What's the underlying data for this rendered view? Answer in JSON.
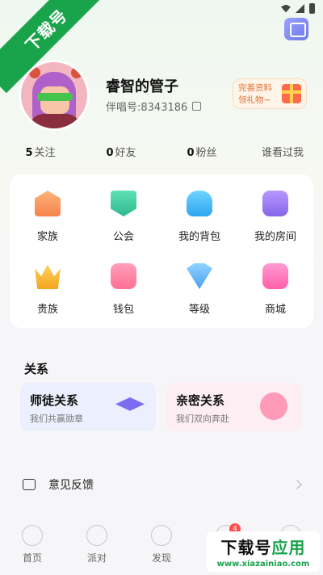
{
  "watermark": {
    "corner_text": "下载号",
    "brand_prefix": "下载号",
    "brand_suffix": "应用",
    "brand_url": "www.xiazainiao.com"
  },
  "profile": {
    "username": "睿智的管子",
    "uid": "伴唱号:8343186",
    "complete_card_line1": "完善资料",
    "complete_card_line2": "领礼物~"
  },
  "stats": [
    {
      "count": "5",
      "label": "关注"
    },
    {
      "count": "0",
      "label": "好友"
    },
    {
      "count": "0",
      "label": "粉丝"
    },
    {
      "count": "",
      "label": "谁看过我"
    }
  ],
  "grid": [
    {
      "label": "家族",
      "icon": "family-icon"
    },
    {
      "label": "公会",
      "icon": "guild-icon"
    },
    {
      "label": "我的背包",
      "icon": "backpack-icon"
    },
    {
      "label": "我的房间",
      "icon": "room-icon"
    },
    {
      "label": "贵族",
      "icon": "crown-icon"
    },
    {
      "label": "钱包",
      "icon": "wallet-icon"
    },
    {
      "label": "等级",
      "icon": "level-icon"
    },
    {
      "label": "商城",
      "icon": "mall-icon"
    }
  ],
  "relations": {
    "title": "关系",
    "master": {
      "title": "师徒关系",
      "subtitle": "我们共赢勋章"
    },
    "intimate": {
      "title": "亲密关系",
      "subtitle": "我们双向奔赴"
    }
  },
  "feedback": {
    "label": "意见反馈"
  },
  "tabbar": [
    {
      "label": "首页"
    },
    {
      "label": "派对"
    },
    {
      "label": "发现"
    },
    {
      "label": "",
      "badge": "4"
    },
    {
      "label": ""
    }
  ]
}
